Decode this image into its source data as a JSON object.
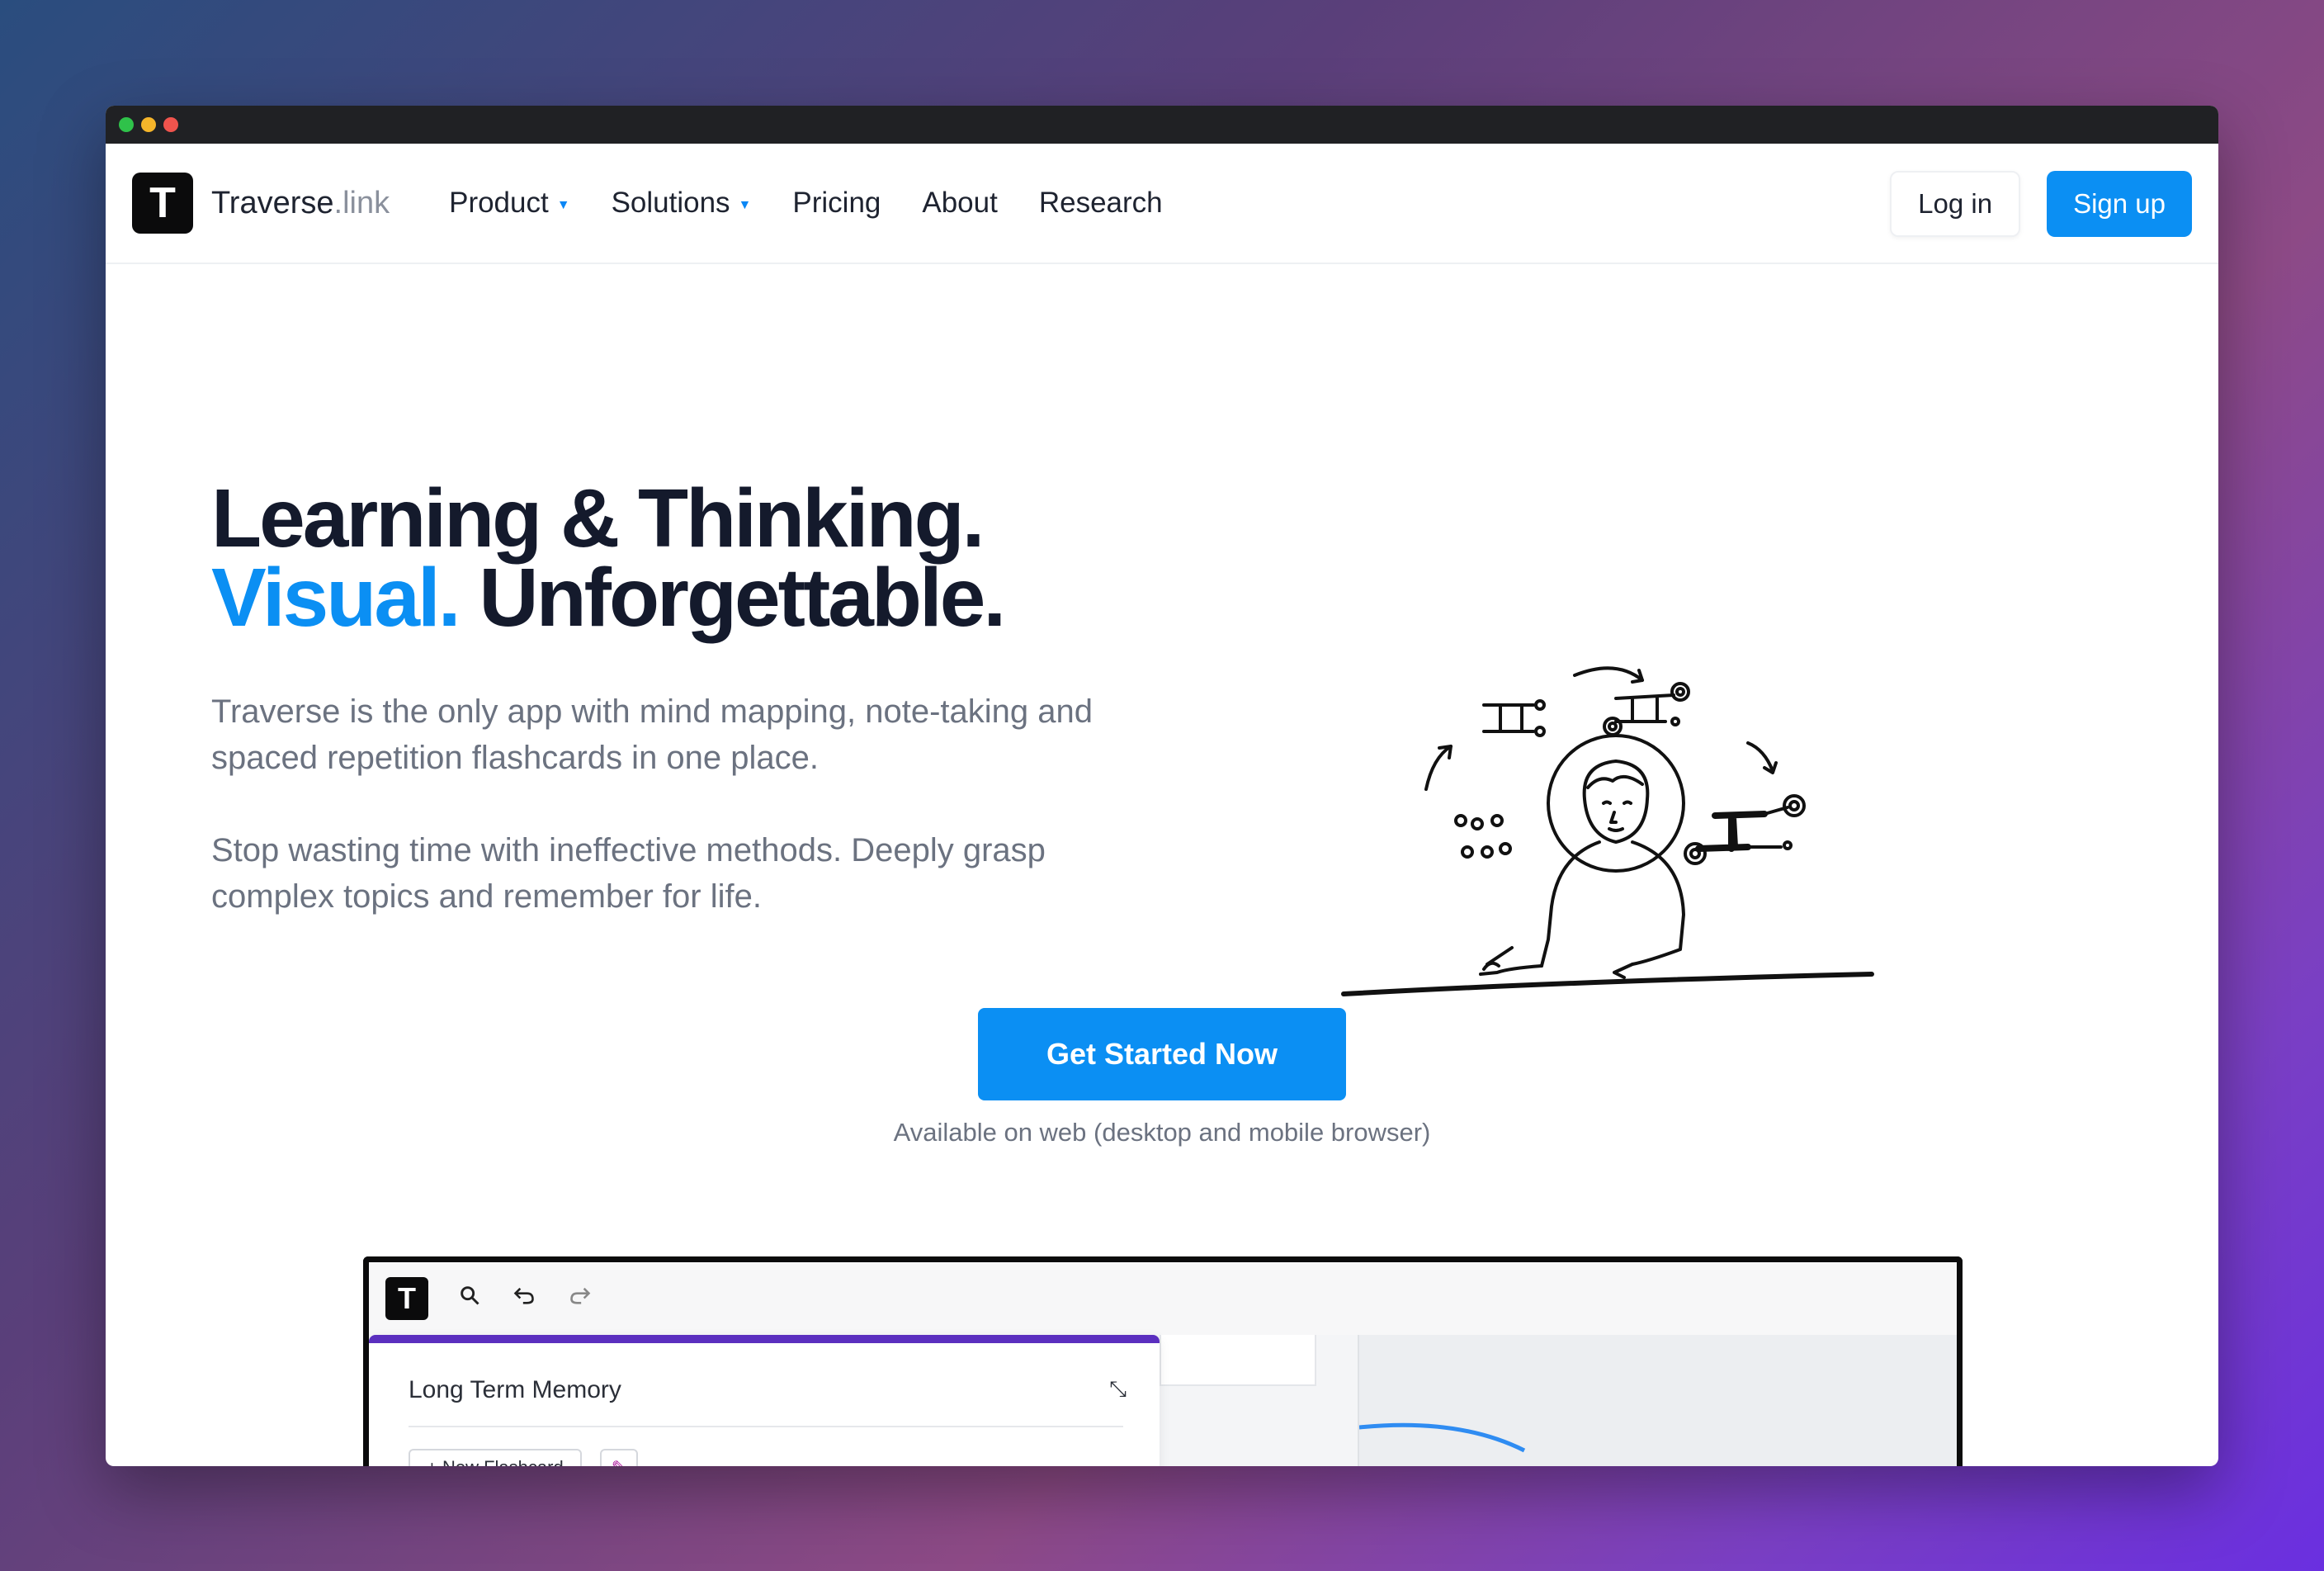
{
  "nav": {
    "brand_main": "Traverse",
    "brand_ext": ".link",
    "logo_letter": "T",
    "items": [
      {
        "label": "Product",
        "has_caret": true
      },
      {
        "label": "Solutions",
        "has_caret": true
      },
      {
        "label": "Pricing",
        "has_caret": false
      },
      {
        "label": "About",
        "has_caret": false
      },
      {
        "label": "Research",
        "has_caret": false
      }
    ],
    "login_label": "Log in",
    "signup_label": "Sign up"
  },
  "hero": {
    "title_line1": "Learning & Thinking.",
    "title_accent": "Visual.",
    "title_rest": "Unforgettable.",
    "paragraph1": "Traverse is the only app with mind mapping, note-taking and spaced repetition flashcards in one place.",
    "paragraph2": "Stop wasting time with ineffective methods. Deeply grasp complex topics and remember for life."
  },
  "cta": {
    "label": "Get Started Now",
    "subtext": "Available on web (desktop and mobile browser)"
  },
  "app_preview": {
    "logo_letter": "T",
    "card_title": "Long Term Memory",
    "new_flashcard_label": "+ New Flashcard"
  },
  "icons": {
    "caret": "caret-down-icon",
    "search": "search-icon",
    "undo": "undo-icon",
    "redo": "redo-icon",
    "collapse": "collapse-icon",
    "chat": "chat-sparkle-icon"
  },
  "colors": {
    "accent": "#0b8ff3",
    "title": "#141a2c",
    "body_text": "#6b7280",
    "card_top": "#5b2fbf"
  }
}
